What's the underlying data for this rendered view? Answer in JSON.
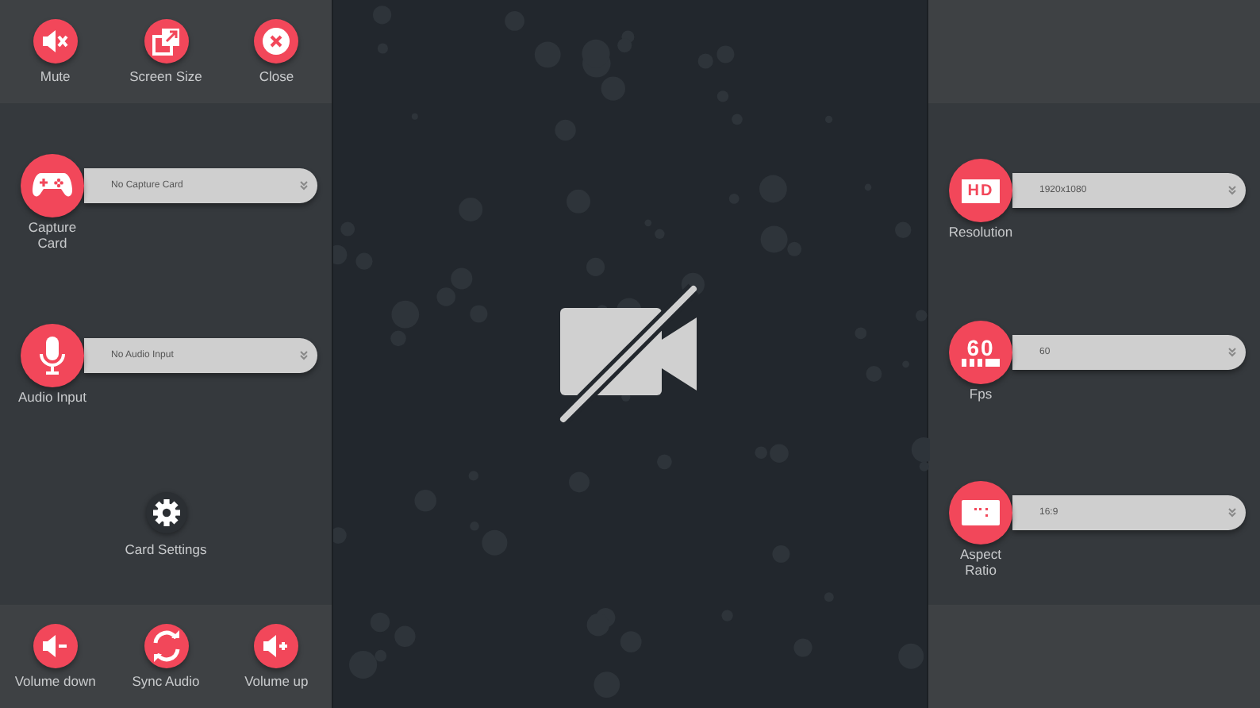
{
  "left_top_buttons": [
    {
      "kind": "mute",
      "label": "Mute"
    },
    {
      "kind": "screen-size",
      "label": "Screen Size"
    },
    {
      "kind": "close",
      "label": "Close"
    }
  ],
  "left_selectors": [
    {
      "kind": "gamepad",
      "label": "Capture Card",
      "value": "No Capture Card"
    },
    {
      "kind": "microphone",
      "label": "Audio Input",
      "value": "No Audio Input"
    }
  ],
  "card_settings": {
    "label": "Card Settings"
  },
  "left_bottom_buttons": [
    {
      "kind": "volume-down",
      "label": "Volume down"
    },
    {
      "kind": "sync",
      "label": "Sync Audio"
    },
    {
      "kind": "volume-up",
      "label": "Volume up"
    }
  ],
  "right_selectors": [
    {
      "kind": "hd",
      "badge": "HD",
      "label": "Resolution",
      "value": "1920x1080"
    },
    {
      "kind": "fps",
      "badge": "60",
      "label": "Fps",
      "value": "60"
    },
    {
      "kind": "aspect",
      "label": "Aspect Ratio",
      "value": "16:9"
    }
  ]
}
